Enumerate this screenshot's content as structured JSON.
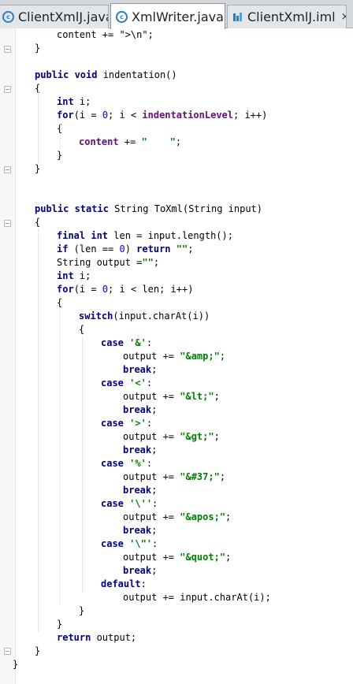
{
  "tabs": [
    {
      "label": "ClientXmlJ.java",
      "icon": "java-class-icon",
      "close": "×",
      "active": false
    },
    {
      "label": "XmlWriter.java",
      "icon": "java-class-icon",
      "close": "×",
      "active": true
    },
    {
      "label": "ClientXmlJ.iml",
      "icon": "iml-module-icon",
      "close": "×",
      "active": false
    }
  ],
  "colors": {
    "keyword": "#000080",
    "string": "#008000",
    "number": "#0000ff",
    "field": "#660e7a"
  },
  "code": {
    "lines": [
      [
        {
          "t": "content += \">\\n\";"
        }
      ],
      [
        {
          "t": "}"
        }
      ],
      [
        {
          "t": "public void",
          "c": "kw"
        },
        {
          "t": " indentation()"
        }
      ],
      [
        {
          "t": "{"
        }
      ],
      [
        {
          "t": "int",
          "c": "kw"
        },
        {
          "t": " i;"
        }
      ],
      [
        {
          "t": "for",
          "c": "kw"
        },
        {
          "t": "(i = "
        },
        {
          "t": "0",
          "c": "num"
        },
        {
          "t": "; i < "
        },
        {
          "t": "indentationLevel",
          "c": "fld"
        },
        {
          "t": "; i++)"
        }
      ],
      [
        {
          "t": "{"
        }
      ],
      [
        {
          "t": "content",
          "c": "fld"
        },
        {
          "t": " += "
        },
        {
          "t": "\"    \"",
          "c": "str"
        },
        {
          "t": ";"
        }
      ],
      [
        {
          "t": "}"
        }
      ],
      [
        {
          "t": "}"
        }
      ],
      [
        {
          "t": "public static",
          "c": "kw"
        },
        {
          "t": " String ToXml(String input)"
        }
      ],
      [
        {
          "t": "{"
        }
      ],
      [
        {
          "t": "final int",
          "c": "kw"
        },
        {
          "t": " len = input.length();"
        }
      ],
      [
        {
          "t": "if",
          "c": "kw"
        },
        {
          "t": " (len == "
        },
        {
          "t": "0",
          "c": "num"
        },
        {
          "t": ") "
        },
        {
          "t": "return",
          "c": "kw"
        },
        {
          "t": " "
        },
        {
          "t": "\"\"",
          "c": "str"
        },
        {
          "t": ";"
        }
      ],
      [
        {
          "t": "String output ="
        },
        {
          "t": "\"\"",
          "c": "str"
        },
        {
          "t": ";"
        }
      ],
      [
        {
          "t": "int",
          "c": "kw"
        },
        {
          "t": " i;"
        }
      ],
      [
        {
          "t": "for",
          "c": "kw"
        },
        {
          "t": "(i = "
        },
        {
          "t": "0",
          "c": "num"
        },
        {
          "t": "; i < len; i++)"
        }
      ],
      [
        {
          "t": "{"
        }
      ],
      [
        {
          "t": "switch",
          "c": "kw"
        },
        {
          "t": "(input.charAt(i))"
        }
      ],
      [
        {
          "t": "{"
        }
      ],
      [
        {
          "t": "case",
          "c": "kw"
        },
        {
          "t": " "
        },
        {
          "t": "'&'",
          "c": "str"
        },
        {
          "t": ":"
        }
      ],
      [
        {
          "t": "output += "
        },
        {
          "t": "\"&amp;\"",
          "c": "str"
        },
        {
          "t": ";"
        }
      ],
      [
        {
          "t": "break",
          "c": "kw"
        },
        {
          "t": ";"
        }
      ],
      [
        {
          "t": "case",
          "c": "kw"
        },
        {
          "t": " "
        },
        {
          "t": "'<'",
          "c": "str"
        },
        {
          "t": ":"
        }
      ],
      [
        {
          "t": "output += "
        },
        {
          "t": "\"&lt;\"",
          "c": "str"
        },
        {
          "t": ";"
        }
      ],
      [
        {
          "t": "break",
          "c": "kw"
        },
        {
          "t": ";"
        }
      ],
      [
        {
          "t": "case",
          "c": "kw"
        },
        {
          "t": " "
        },
        {
          "t": "'>'",
          "c": "str"
        },
        {
          "t": ":"
        }
      ],
      [
        {
          "t": "output += "
        },
        {
          "t": "\"&gt;\"",
          "c": "str"
        },
        {
          "t": ";"
        }
      ],
      [
        {
          "t": "break",
          "c": "kw"
        },
        {
          "t": ";"
        }
      ],
      [
        {
          "t": "case",
          "c": "kw"
        },
        {
          "t": " "
        },
        {
          "t": "'%'",
          "c": "str"
        },
        {
          "t": ":"
        }
      ],
      [
        {
          "t": "output += "
        },
        {
          "t": "\"&#37;\"",
          "c": "str"
        },
        {
          "t": ";"
        }
      ],
      [
        {
          "t": "break",
          "c": "kw"
        },
        {
          "t": ";"
        }
      ],
      [
        {
          "t": "case",
          "c": "kw"
        },
        {
          "t": " "
        },
        {
          "t": "'\\''",
          "c": "str"
        },
        {
          "t": ":"
        }
      ],
      [
        {
          "t": "output += "
        },
        {
          "t": "\"&apos;\"",
          "c": "str"
        },
        {
          "t": ";"
        }
      ],
      [
        {
          "t": "break",
          "c": "kw"
        },
        {
          "t": ";"
        }
      ],
      [
        {
          "t": "case",
          "c": "kw"
        },
        {
          "t": " "
        },
        {
          "t": "'\\\"'",
          "c": "str"
        },
        {
          "t": ":"
        }
      ],
      [
        {
          "t": "output += "
        },
        {
          "t": "\"&quot;\"",
          "c": "str"
        },
        {
          "t": ";"
        }
      ],
      [
        {
          "t": "break",
          "c": "kw"
        },
        {
          "t": ";"
        }
      ],
      [
        {
          "t": "default",
          "c": "kw"
        },
        {
          "t": ":"
        }
      ],
      [
        {
          "t": "output += input.charAt(i);"
        }
      ],
      [
        {
          "t": "}"
        }
      ],
      [
        {
          "t": "}"
        }
      ],
      [
        {
          "t": "return",
          "c": "kw"
        },
        {
          "t": " output;"
        }
      ],
      [
        {
          "t": "}"
        }
      ],
      [
        {
          "t": "}"
        }
      ]
    ]
  }
}
